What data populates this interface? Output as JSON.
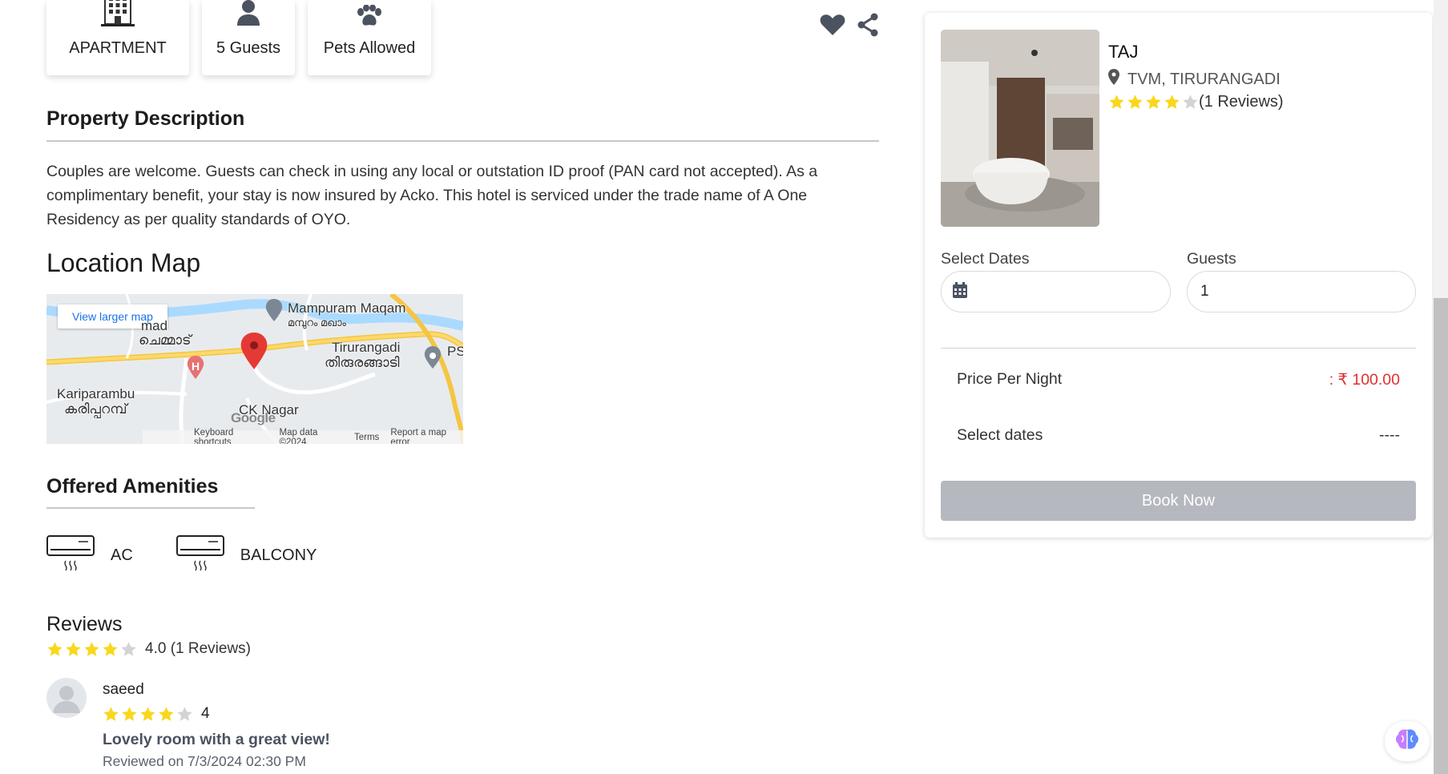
{
  "features": [
    {
      "label": "APARTMENT",
      "icon": "building-icon"
    },
    {
      "label": "5 Guests",
      "icon": "user-icon"
    },
    {
      "label": "Pets Allowed",
      "icon": "paw-icon"
    }
  ],
  "actions": {
    "favorite_icon": "heart-icon",
    "share_icon": "share-icon"
  },
  "description": {
    "title": "Property Description",
    "text": "Couples are welcome. Guests can check in using any local or outstation ID proof (PAN card not accepted). As a complimentary benefit, your stay is now insured by Acko. This hotel is serviced under the trade name of A One Residency as per quality standards of OYO."
  },
  "location": {
    "title": "Location Map",
    "view_larger": "View larger map",
    "labels": {
      "mampuram": "Mampuram Maqam",
      "mampuram_ml": "മമ്പുറം മഖാം",
      "chemmad_en": "Chemmad",
      "chemmad_ml": "ചെമ്മാട്",
      "tirurangadi": "Tirurangadi",
      "tirurangadi_ml": "തിരുരങ്ങാടി",
      "kariparambu": "Kariparambu",
      "kariparambu_ml": "കരിപ്പറമ്പ്",
      "cknagar": "CK Nagar",
      "ps": "PS"
    },
    "google": "Google",
    "footer": {
      "shortcuts": "Keyboard shortcuts",
      "mapdata": "Map data ©2024",
      "terms": "Terms",
      "report": "Report a map error"
    }
  },
  "amenities": {
    "title": "Offered Amenities",
    "items": [
      {
        "label": "AC",
        "icon": "air-conditioner-icon"
      },
      {
        "label": "BALCONY",
        "icon": "air-conditioner-icon"
      }
    ]
  },
  "reviews": {
    "title": "Reviews",
    "summary": "4.0 (1 Reviews)",
    "rating": 4,
    "items": [
      {
        "name": "saeed",
        "rating": "4",
        "text": "Lovely room with a great view!",
        "date": "Reviewed on 7/3/2024 02:30 PM"
      }
    ]
  },
  "booking": {
    "hotel_name": "TAJ",
    "location": "TVM, TIRURANGADI",
    "rating": 4,
    "reviews_count": "(1 Reviews)",
    "dates_label": "Select Dates",
    "guests_label": "Guests",
    "guests_value": "1",
    "price_label": "Price Per Night",
    "price_value": ": ₹ 100.00",
    "select_dates_label": "Select dates",
    "select_dates_value": "----",
    "book_button": "Book Now"
  },
  "colors": {
    "star": "#f9d71c",
    "star_empty": "#d3d3d3",
    "price": "#e03030",
    "button": "#b5b8be",
    "icon": "#4b5260"
  }
}
